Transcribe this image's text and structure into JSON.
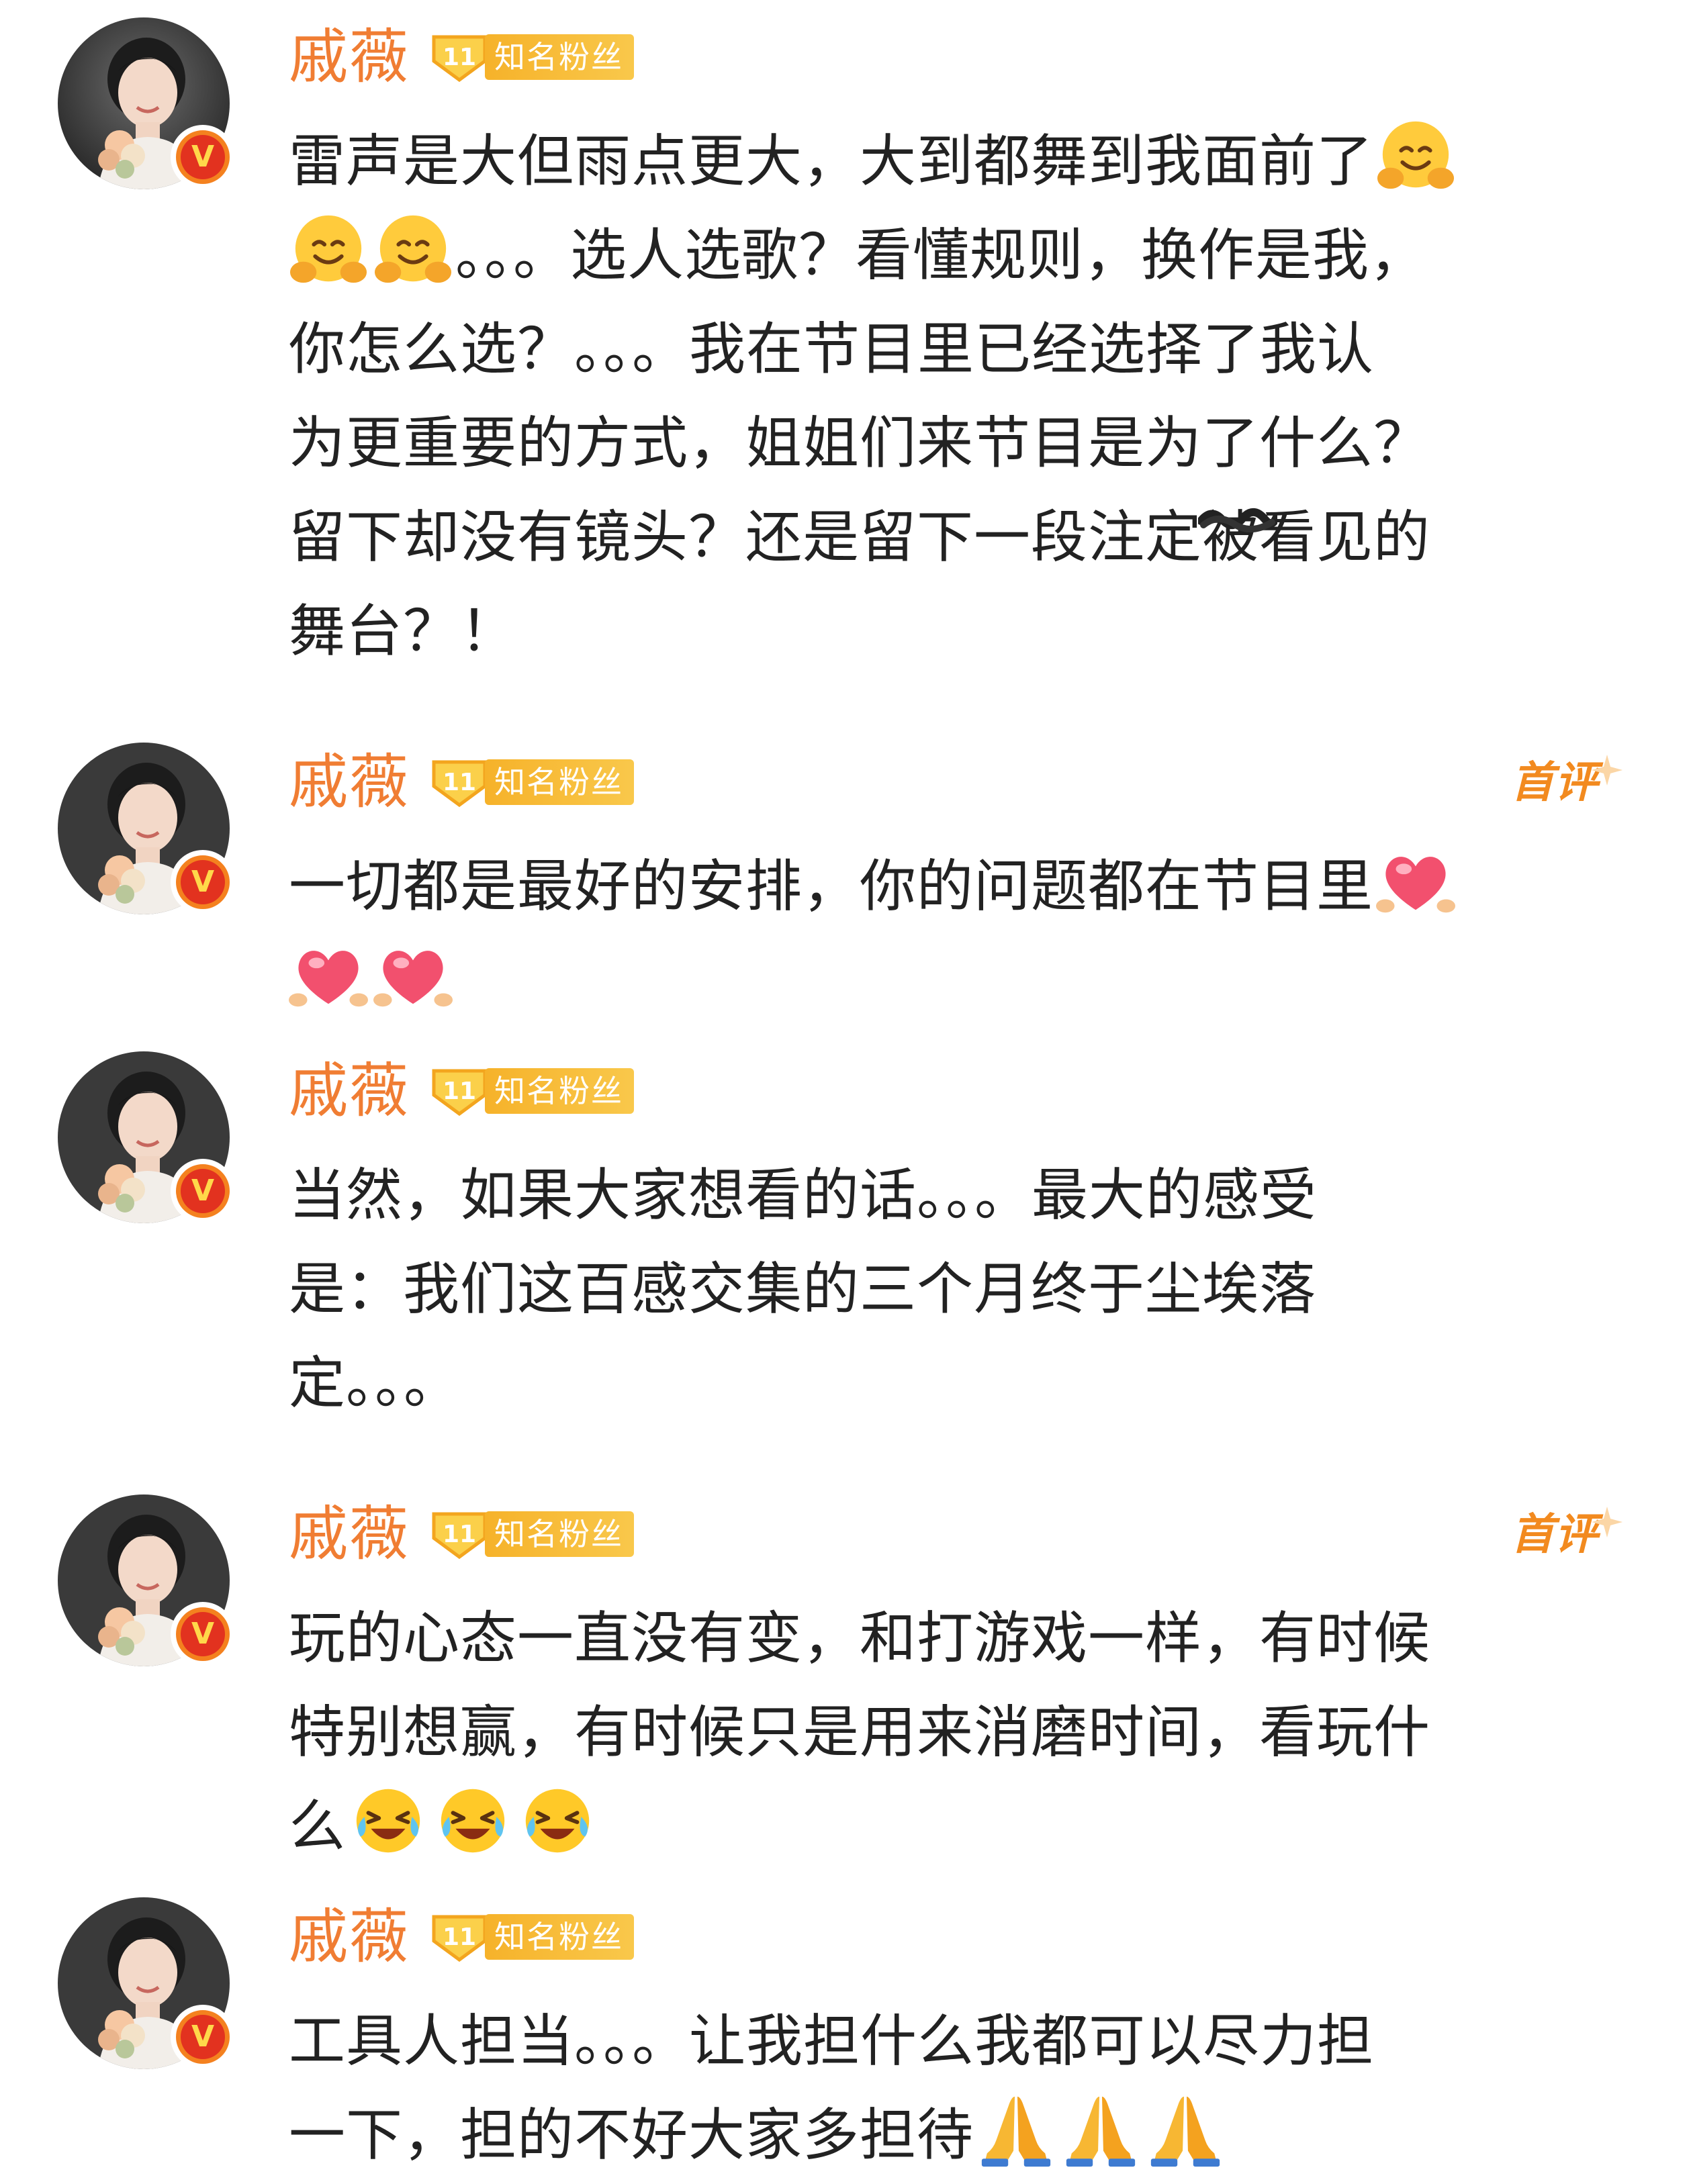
{
  "comments": [
    {
      "username": "戚薇",
      "fan_level": "11",
      "fan_label": "知名粉丝",
      "first_tag": "",
      "lines": [
        [
          "雷声是大但雨点更大，大到都舞到我面前了",
          "[hug]"
        ],
        [
          "[hug]",
          "[hug]",
          "。。。选人选歌？看懂规则，换作是我，"
        ],
        [
          "你怎么选？。。。我在节目里已经选择了我认"
        ],
        [
          "为更重要的方式，姐姐们来节目是为了什么？"
        ],
        [
          "留下却没有镜头？还是留下一段注定",
          "[redact]被",
          "看见的"
        ],
        [
          "舞台？！"
        ]
      ]
    },
    {
      "username": "戚薇",
      "fan_level": "11",
      "fan_label": "知名粉丝",
      "first_tag": "首评",
      "lines": [
        [
          "一切都是最好的安排，你的问题都在节目里",
          "[heart]"
        ],
        [
          "[heart]",
          "[heart]"
        ]
      ]
    },
    {
      "username": "戚薇",
      "fan_level": "11",
      "fan_label": "知名粉丝",
      "first_tag": "",
      "lines": [
        [
          "当然，如果大家想看的话。。。最大的感受"
        ],
        [
          "是：我们这百感交集的三个月终于尘埃落"
        ],
        [
          "定。。。"
        ]
      ]
    },
    {
      "username": "戚薇",
      "fan_level": "11",
      "fan_label": "知名粉丝",
      "first_tag": "首评",
      "lines": [
        [
          "玩的心态一直没有变，和打游戏一样，有时候"
        ],
        [
          "特别想赢，有时候只是用来消磨时间，看玩什"
        ],
        [
          "么",
          "[laughcry]",
          "[laughcry]",
          "[laughcry]"
        ]
      ]
    },
    {
      "username": "戚薇",
      "fan_level": "11",
      "fan_label": "知名粉丝",
      "first_tag": "",
      "lines": [
        [
          "工具人担当。。。让我担什么我都可以尽力担"
        ],
        [
          "一下，担的不好大家多担待",
          "[pray]",
          "[pray]",
          "[pray]"
        ]
      ]
    }
  ],
  "icons": {
    "hug": "hugging-face-icon",
    "heart": "floating-heart-icon",
    "laughcry": "laugh-cry-icon",
    "pray": "praying-hands-icon",
    "verified": "verified-v-icon",
    "fan": "fan-level-shield-icon"
  },
  "colors": {
    "username": "#f07d33",
    "fan_badge": "#f6b22a",
    "first_tag": "#f28a1f",
    "text": "#222222",
    "verified": "#e2321f"
  },
  "verified_glyph": "V"
}
